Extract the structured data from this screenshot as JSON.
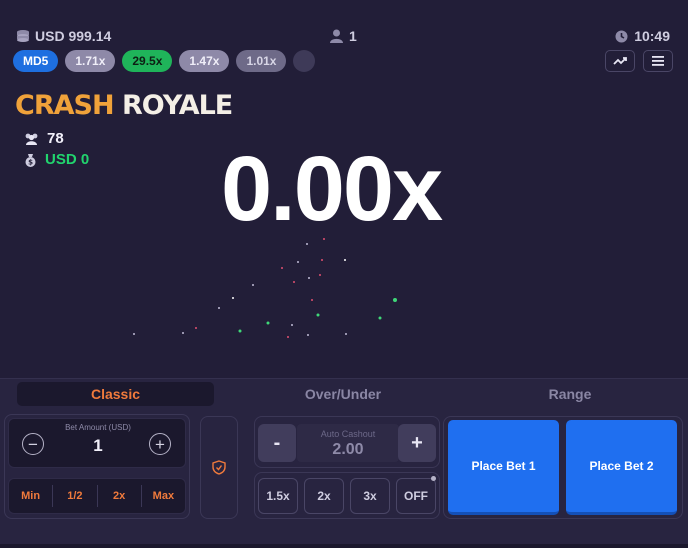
{
  "header": {
    "balance": "USD 999.14",
    "players_online": "1",
    "time": "10:49"
  },
  "history": {
    "seed_label": "MD5",
    "multipliers": [
      "1.71x",
      "29.5x",
      "1.47x",
      "1.01x"
    ]
  },
  "game": {
    "logo_part1": "CRASH",
    "logo_part2": "ROYALE",
    "bettors": "78",
    "total_bet": "USD 0",
    "multiplier": "0.00x"
  },
  "tabs": [
    "Classic",
    "Over/Under",
    "Range"
  ],
  "bet": {
    "label": "Bet Amount (USD)",
    "value": "1",
    "minus": "−",
    "plus": "+",
    "quick": [
      "Min",
      "1/2",
      "2x",
      "Max"
    ]
  },
  "auto_cashout": {
    "label": "Auto Cashout",
    "value": "2.00",
    "minus": "-",
    "plus": "+",
    "presets": [
      "1.5x",
      "2x",
      "3x",
      "OFF"
    ]
  },
  "actions": {
    "place_bet_1": "Place Bet 1",
    "place_bet_2": "Place Bet 2"
  },
  "colors": {
    "background": "#221e38",
    "accent_orange": "#f07a3c",
    "accent_blue": "#1f6ff0",
    "accent_green": "#21d46e"
  }
}
